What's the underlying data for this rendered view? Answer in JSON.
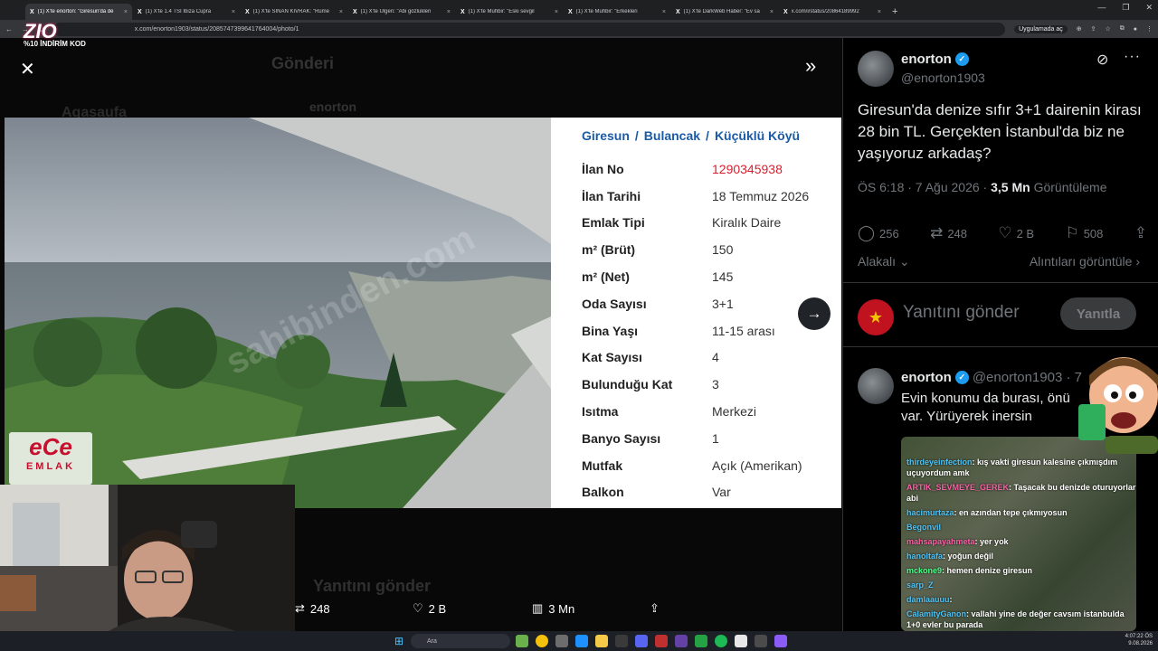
{
  "browser": {
    "tabs": [
      {
        "title": "(1) X'te enorton: \"Giresun'da de",
        "active": true
      },
      {
        "title": "(1) X'te 1.4 TSI Ibiza Cupra"
      },
      {
        "title": "(1) X'te SINAN KIVRAK: \"Rüme"
      },
      {
        "title": "(1) X'te Ülgen: \"Abi gözlükleri"
      },
      {
        "title": "(1) X'te Muhbir: \"Eski sevgil"
      },
      {
        "title": "(1) X'te Muhbir: \"Erkekleri"
      },
      {
        "title": "(1) X'te DarkWeb Haber: \"Ev sa"
      },
      {
        "title": "x.com/i/status/20864189992"
      }
    ],
    "url": "x.com/enorton1903/status/2085747399641764004/photo/1",
    "app_pill": "Uygulamada aç"
  },
  "overlay": {
    "logo": "ZIO",
    "discount": "%10 İNDİRİM KOD"
  },
  "viewer": {
    "bg_header": "Gönderi",
    "bg_user": "enorton",
    "bg_user2": "Agasaufa",
    "bg_reply": "Yanıtını gönder",
    "watermark": "sahibinden.com",
    "ece": "eCe",
    "emlak": "EMLAK",
    "actions": {
      "retweets": "248",
      "likes": "2 B",
      "views": "3 Mn"
    }
  },
  "listing": {
    "crumb": [
      "Giresun",
      "Bulancak",
      "Küçüklü Köyü"
    ],
    "rows": [
      {
        "k": "İlan No",
        "v": "1290345938",
        "red": true
      },
      {
        "k": "İlan Tarihi",
        "v": "18 Temmuz 2026"
      },
      {
        "k": "Emlak Tipi",
        "v": "Kiralık Daire"
      },
      {
        "k": "m² (Brüt)",
        "v": "150"
      },
      {
        "k": "m² (Net)",
        "v": "145"
      },
      {
        "k": "Oda Sayısı",
        "v": "3+1"
      },
      {
        "k": "Bina Yaşı",
        "v": "11-15 arası"
      },
      {
        "k": "Kat Sayısı",
        "v": "4"
      },
      {
        "k": "Bulunduğu Kat",
        "v": "3"
      },
      {
        "k": "Isıtma",
        "v": "Merkezi"
      },
      {
        "k": "Banyo Sayısı",
        "v": "1"
      },
      {
        "k": "Mutfak",
        "v": "Açık (Amerikan)"
      },
      {
        "k": "Balkon",
        "v": "Var"
      }
    ]
  },
  "tweet": {
    "name": "enorton",
    "handle": "@enorton1903",
    "text": "Giresun'da denize sıfır 3+1 dairenin kirası 28 bin TL. Gerçekten İstanbul'da biz ne yaşıyoruz arkadaş?",
    "time": "ÖS 6:18 · 7 Ağu 2026 · ",
    "views": "3,5 Mn",
    "views_label": " Görüntüleme",
    "stats": {
      "replies": "256",
      "retweets": "248",
      "likes": "2 B",
      "bookmarks": "508"
    },
    "relevant": "Alakalı",
    "quotes": "Alıntıları görüntüle",
    "reply_placeholder": "Yanıtını gönder",
    "reply_button": "Yanıtla"
  },
  "reply2": {
    "name": "enorton",
    "handle": "@enorton1903 · 7",
    "text": "Evin konumu da burası, önü var. Yürüyerek inersin"
  },
  "chat": [
    {
      "u": "thirdeyeinfection",
      "m": ": kış vakti giresun kalesine çıkmışdım uçuyordum amk",
      "c": ""
    },
    {
      "u": "ARTIK_SEVMEYE_GEREK",
      "m": ": Taşacak bu denizde oturuyorlar abi",
      "c": "pink"
    },
    {
      "u": "hacimurtaza",
      "m": ": en azından tepe çıkmıyosun",
      "c": ""
    },
    {
      "u": "Begonvil",
      "m": "",
      "c": ""
    },
    {
      "u": "mahsapayahmeta",
      "m": ": yer yok",
      "c": "pink"
    },
    {
      "u": "hanoltafa",
      "m": ": yoğun değil",
      "c": ""
    },
    {
      "u": "mckone9",
      "m": ": hemen denize giresun",
      "c": "green"
    },
    {
      "u": "sarp_Z",
      "m": "",
      "c": ""
    },
    {
      "u": "damlaauuu",
      "m": ":",
      "c": ""
    },
    {
      "u": "CalamityGanon",
      "m": ": vallahi yine de değer cavsım istanbulda 1+0 evler bu parada",
      "c": ""
    }
  ],
  "taskbar": {
    "search": "Ara",
    "time": "4:07:22 ÖS",
    "date": "9.08.2026"
  }
}
